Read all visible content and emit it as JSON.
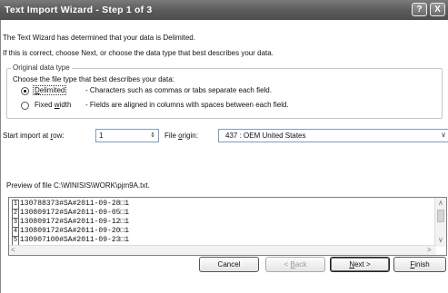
{
  "window": {
    "title": "Text Import Wizard - Step 1 of 3",
    "help_glyph": "?",
    "close_glyph": "X"
  },
  "intro": {
    "line1": "The Text Wizard has determined that your data is Delimited.",
    "line2": "If this is correct, choose Next, or choose the data type that best describes your data."
  },
  "original_data_type": {
    "legend": "Original data type",
    "prompt": "Choose the file type that best describes your data:",
    "options": [
      {
        "label_pre": "",
        "label_key": "D",
        "label_post": "elimited",
        "desc": "- Characters such as commas or tabs separate each field.",
        "checked": true
      },
      {
        "label_pre": "Fixed ",
        "label_key": "w",
        "label_post": "idth",
        "desc": "- Fields are aligned in columns with spaces between each field.",
        "checked": false
      }
    ]
  },
  "start_import": {
    "label_pre": "Start import at ",
    "label_key": "r",
    "label_post": "ow:",
    "value": "1"
  },
  "file_origin": {
    "label_pre": "File ",
    "label_key": "o",
    "label_post": "rigin:",
    "value": "437 : OEM United States"
  },
  "preview": {
    "label": "Preview of file C:\\WINISIS\\WORK\\pjm9A.txt.",
    "rows": [
      {
        "num": "1",
        "text": "130788373#SA#2011-09-28□1"
      },
      {
        "num": "2",
        "text": "130809172#SA#2011-09-05□1"
      },
      {
        "num": "3",
        "text": "130809172#SA#2011-09-12□1"
      },
      {
        "num": "4",
        "text": "130809172#SA#2011-09-20□1"
      },
      {
        "num": "5",
        "text": "130907100#SA#2011-09-23□1"
      }
    ]
  },
  "buttons": {
    "cancel": "Cancel",
    "back_pre": "< ",
    "back_key": "B",
    "back_post": "ack",
    "next_key": "N",
    "next_post": "ext >",
    "finish_key": "F",
    "finish_post": "inish"
  },
  "colors": {
    "titlebar": "#5a5a5a",
    "field_border": "#7f9db9"
  }
}
